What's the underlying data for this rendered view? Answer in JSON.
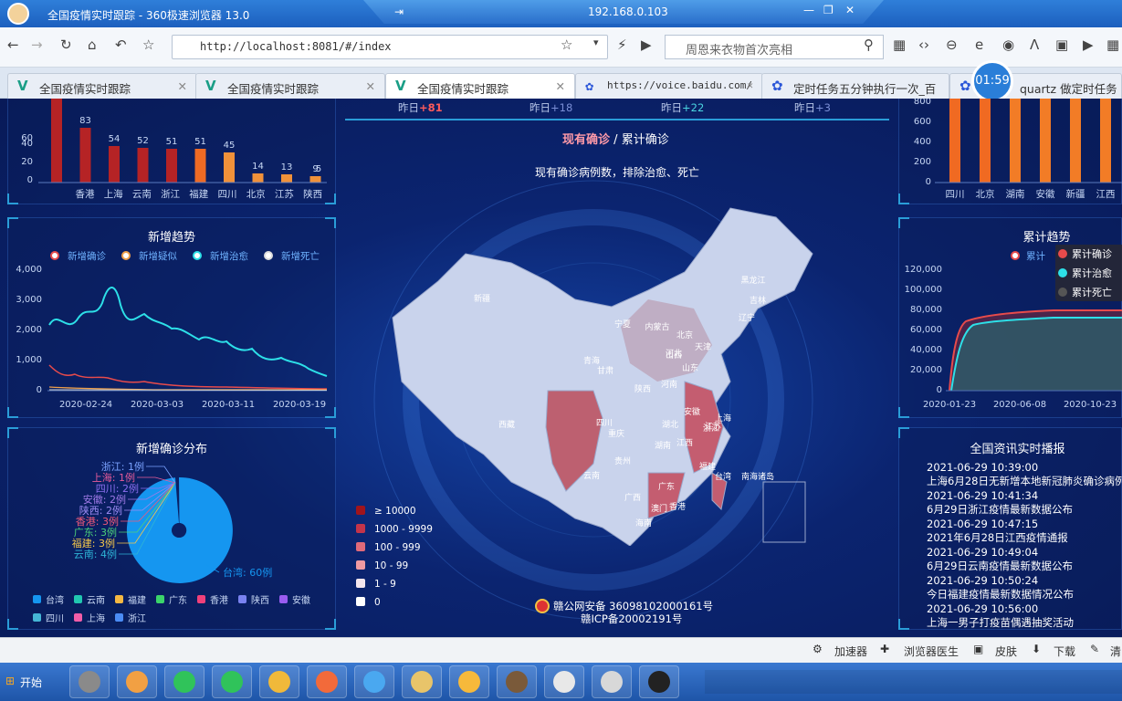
{
  "browser": {
    "title": "全国疫情实时跟踪 - 360极速浏览器 13.0",
    "ip": "192.168.0.103",
    "url": "http://localhost:8081/#/index",
    "search_placeholder": "周恩来衣物首次亮相",
    "clock": "01:59"
  },
  "tabs": [
    {
      "label": "全国疫情实时跟踪"
    },
    {
      "label": "全国疫情实时跟踪"
    },
    {
      "label": "全国疫情实时跟踪"
    },
    {
      "label": "https://voice.baidu.com/"
    },
    {
      "label": "定时任务五分钟执行一次_百"
    },
    {
      "label": "quartz 做定时任务"
    }
  ],
  "top_stats": [
    {
      "label": "昨日",
      "value": "+81"
    },
    {
      "label": "昨日",
      "value": "+18"
    },
    {
      "label": "昨日",
      "value": "+22"
    },
    {
      "label": "昨日",
      "value": "+3"
    }
  ],
  "left_bar": {
    "values": [
      "83",
      "54",
      "52",
      "51",
      "51",
      "45",
      "14",
      "13",
      "9",
      "5"
    ],
    "categories": [
      "香港",
      "上海",
      "云南",
      "浙江",
      "福建",
      "四川",
      "北京",
      "江苏",
      "陕西"
    ],
    "yticks": [
      "0",
      "20",
      "40",
      "60"
    ]
  },
  "trend": {
    "title": "新增趋势",
    "legend": [
      "新增确诊",
      "新增疑似",
      "新增治愈",
      "新增死亡"
    ],
    "yticks": [
      "0",
      "1,000",
      "2,000",
      "3,000",
      "4,000"
    ],
    "xticks": [
      "2020-02-24",
      "2020-03-03",
      "2020-03-11",
      "2020-03-19"
    ]
  },
  "pie": {
    "title": "新增确诊分布",
    "labels": [
      "浙江: 1例",
      "上海: 1例",
      "四川: 2例",
      "安徽: 2例",
      "陕西: 2例",
      "香港: 3例",
      "广东: 3例",
      "福建: 3例",
      "云南: 4例",
      "台湾: 60例"
    ],
    "legend": [
      "台湾",
      "云南",
      "福建",
      "广东",
      "香港",
      "陕西",
      "安徽",
      "四川",
      "上海",
      "浙江"
    ]
  },
  "map": {
    "switch_active": "现有确诊",
    "switch_sep": "/",
    "switch_other": "累计确诊",
    "subtitle": "现有确诊病例数，排除治愈、死亡",
    "ranges": [
      "≥ 10000",
      "1000 - 9999",
      "100 - 999",
      "10 - 99",
      "1 - 9",
      "0"
    ],
    "provinces": [
      "新疆",
      "西藏",
      "青海",
      "甘肃",
      "宁夏",
      "内蒙古",
      "黑龙江",
      "吉林",
      "辽宁",
      "北京",
      "天津",
      "河北",
      "山西",
      "陕西",
      "山东",
      "河南",
      "四川",
      "重庆",
      "湖北",
      "安徽",
      "江苏",
      "上海",
      "浙江",
      "江西",
      "湖南",
      "贵州",
      "云南",
      "广西",
      "广东",
      "福建",
      "台湾",
      "澳门",
      "香港",
      "海南",
      "南海诸岛"
    ],
    "footer1": "赣公网安备 36098102000161号",
    "footer2": "赣ICP备20002191号"
  },
  "right_bar": {
    "categories": [
      "四川",
      "北京",
      "湖南",
      "安徽",
      "新疆",
      "江西"
    ],
    "yticks": [
      "0",
      "200",
      "400",
      "600",
      "800"
    ]
  },
  "cumulative": {
    "title": "累计趋势",
    "legend_short": "累计",
    "legend": [
      "累计确诊",
      "累计治愈",
      "累计死亡"
    ],
    "yticks": [
      "0",
      "20,000",
      "40,000",
      "60,000",
      "80,000",
      "100,000",
      "120,000"
    ],
    "xticks": [
      "2020-01-23",
      "2020-06-08",
      "2020-10-23"
    ]
  },
  "news": {
    "title": "全国资讯实时播报",
    "items": [
      {
        "date": "2021-06-29 10:39:00",
        "text": "上海6月28日无新增本地新冠肺炎确诊病例"
      },
      {
        "date": "2021-06-29 10:41:34",
        "text": "6月29日浙江疫情最新数据公布"
      },
      {
        "date": "2021-06-29 10:47:15",
        "text": "2021年6月28日江西疫情通报"
      },
      {
        "date": "2021-06-29 10:49:04",
        "text": "6月29日云南疫情最新数据公布"
      },
      {
        "date": "2021-06-29 10:50:24",
        "text": "今日福建疫情最新数据情况公布"
      },
      {
        "date": "2021-06-29 10:56:00",
        "text": "上海一男子打疫苗偶遇抽奖活动"
      }
    ]
  },
  "status": {
    "items": [
      "加速器",
      "浏览器医生",
      "皮肤",
      "下载",
      "清"
    ]
  },
  "taskbar": {
    "start": "开始"
  },
  "colors": {
    "red_bar": "#c0282e",
    "orange_bar": "#f07a22",
    "cyan": "#2de0e8",
    "pie_blue": "#1596f0"
  }
}
